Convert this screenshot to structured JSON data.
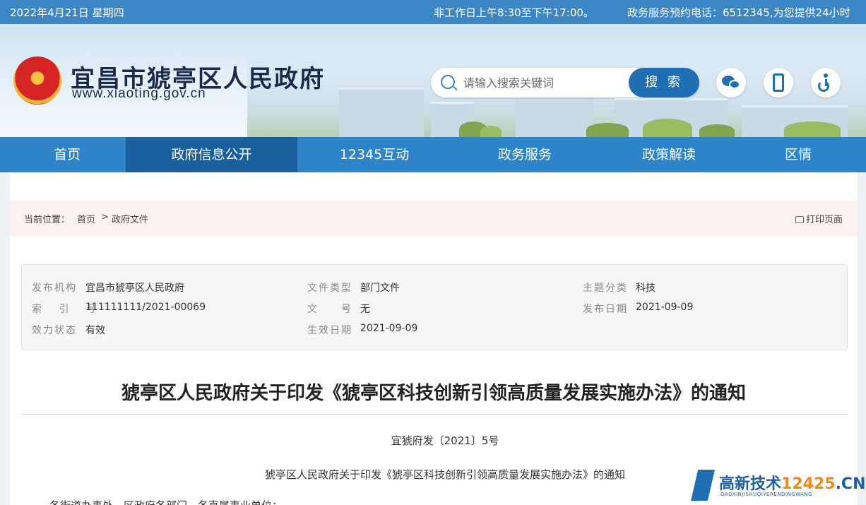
{
  "topbar": {
    "date": "2022年4月21日 星期四",
    "hours": "非工作日上午8:30至下午17:00。",
    "phone": "政务服务预约电话：6512345,为您提供24小时"
  },
  "header": {
    "site_name": "宜昌市猇亭区人民政府",
    "site_url": "www.xiaoting.gov.cn",
    "search_placeholder": "请输入搜索关键词",
    "search_button": "搜 索"
  },
  "nav": {
    "items": [
      "首页",
      "政府信息公开",
      "12345互动",
      "政务服务",
      "政策解读",
      "区情"
    ],
    "active_index": 1
  },
  "breadcrumb": {
    "label": "当前位置：",
    "home": "首页",
    "separator": ">",
    "current": "政府文件",
    "print": "打印页面"
  },
  "meta": {
    "issuer_label": "发布机构",
    "issuer": "宜昌市猇亭区人民政府",
    "doc_type_label": "文件类型",
    "doc_type": "部门文件",
    "topic_label": "主题分类",
    "topic": "科技",
    "index_label": "索 引 号",
    "index_no": "111111111/2021-00069",
    "doc_no_label": "文　　号",
    "doc_no": "无",
    "publish_date_label": "发布日期",
    "publish_date": "2021-09-09",
    "status_label": "效力状态",
    "status": "有效",
    "effective_date_label": "生效日期",
    "effective_date": "2021-09-09"
  },
  "article": {
    "title": "猇亭区人民政府关于印发《猇亭区科技创新引领高质量发展实施办法》的通知",
    "doc_number": "宜猇府发〔2021〕5号",
    "subtitle": "猇亭区人民政府关于印发《猇亭区科技创新引领高质量发展实施办法》的通知",
    "first_line": "各街道办事处，区政府各部门，各直属事业单位："
  },
  "watermark": {
    "brand_prefix": "高新技术",
    "brand_number": "12425",
    "brand_suffix": ".CN",
    "pinyin": "GAOXINJISHUQIYERENDINGWANG"
  },
  "colors": {
    "topbar": "#3d86c6",
    "nav": "#2e84c8",
    "nav_active": "#1a5f9e",
    "search_button": "#1f6fb5",
    "breadcrumb_bg": "#fcf2f0"
  }
}
